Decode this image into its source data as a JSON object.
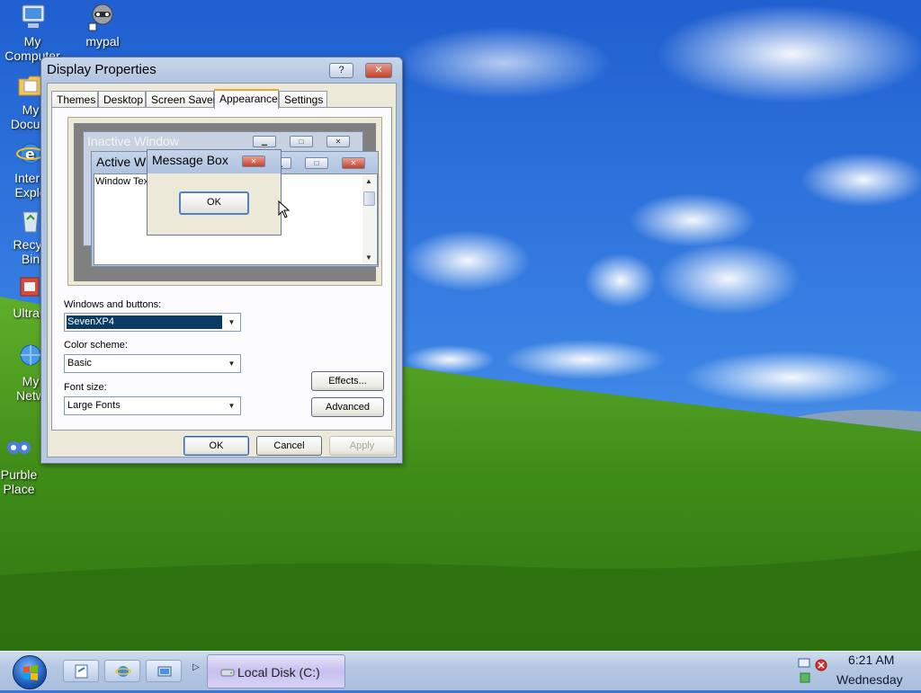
{
  "desktop": {
    "icons": [
      {
        "label_line1": "My",
        "label_line2": "Computer",
        "icon": "computer-icon"
      },
      {
        "label_line1": "mypal",
        "label_line2": "",
        "icon": "raccoon-icon"
      },
      {
        "label_line1": "My",
        "label_line2": "Docum",
        "icon": "documents-folder-icon"
      },
      {
        "label_line1": "Intern",
        "label_line2": "Explo",
        "icon": "internet-explorer-icon"
      },
      {
        "label_line1": "Recyc",
        "label_line2": "Bin",
        "icon": "recycle-bin-icon"
      },
      {
        "label_line1": "Ultrau",
        "label_line2": "",
        "icon": "ultrauxtheme-icon"
      },
      {
        "label_line1": "My",
        "label_line2": "Netw",
        "icon": "network-icon"
      },
      {
        "label_line1": "Purble",
        "label_line2": "Place",
        "icon": "purble-place-icon"
      }
    ]
  },
  "dialog": {
    "title": "Display Properties",
    "help_label": "?",
    "close_label": "✕",
    "tabs": [
      "Themes",
      "Desktop",
      "Screen Saver",
      "Appearance",
      "Settings"
    ],
    "active_tab": "Appearance",
    "preview": {
      "inactive_title": "Inactive Window",
      "active_title": "Active Window",
      "window_text": "Window Text",
      "message_box_title": "Message Box",
      "message_ok": "OK"
    },
    "windows_buttons": {
      "label": "Windows and buttons:",
      "value": "SevenXP4"
    },
    "color_scheme": {
      "label": "Color scheme:",
      "value": "Basic"
    },
    "font_size": {
      "label": "Font size:",
      "value": "Large Fonts"
    },
    "effects_button": "Effects...",
    "advanced_button": "Advanced",
    "ok_button": "OK",
    "cancel_button": "Cancel",
    "apply_button": "Apply"
  },
  "taskbar": {
    "task_label": "Local Disk (C:)",
    "quick_launch": [
      "quick-launch-edit-icon",
      "quick-launch-ie-icon",
      "quick-launch-show-desktop-icon"
    ],
    "more_glyph": "▷",
    "clock_time": "6:21 AM",
    "clock_day": "Wednesday"
  },
  "colors": {
    "sky": "#2f6fd6",
    "grass": "#4c9a1f",
    "taskbar": "#b5c8e3",
    "selection": "#0b3a62",
    "close_red": "#c2432c"
  }
}
